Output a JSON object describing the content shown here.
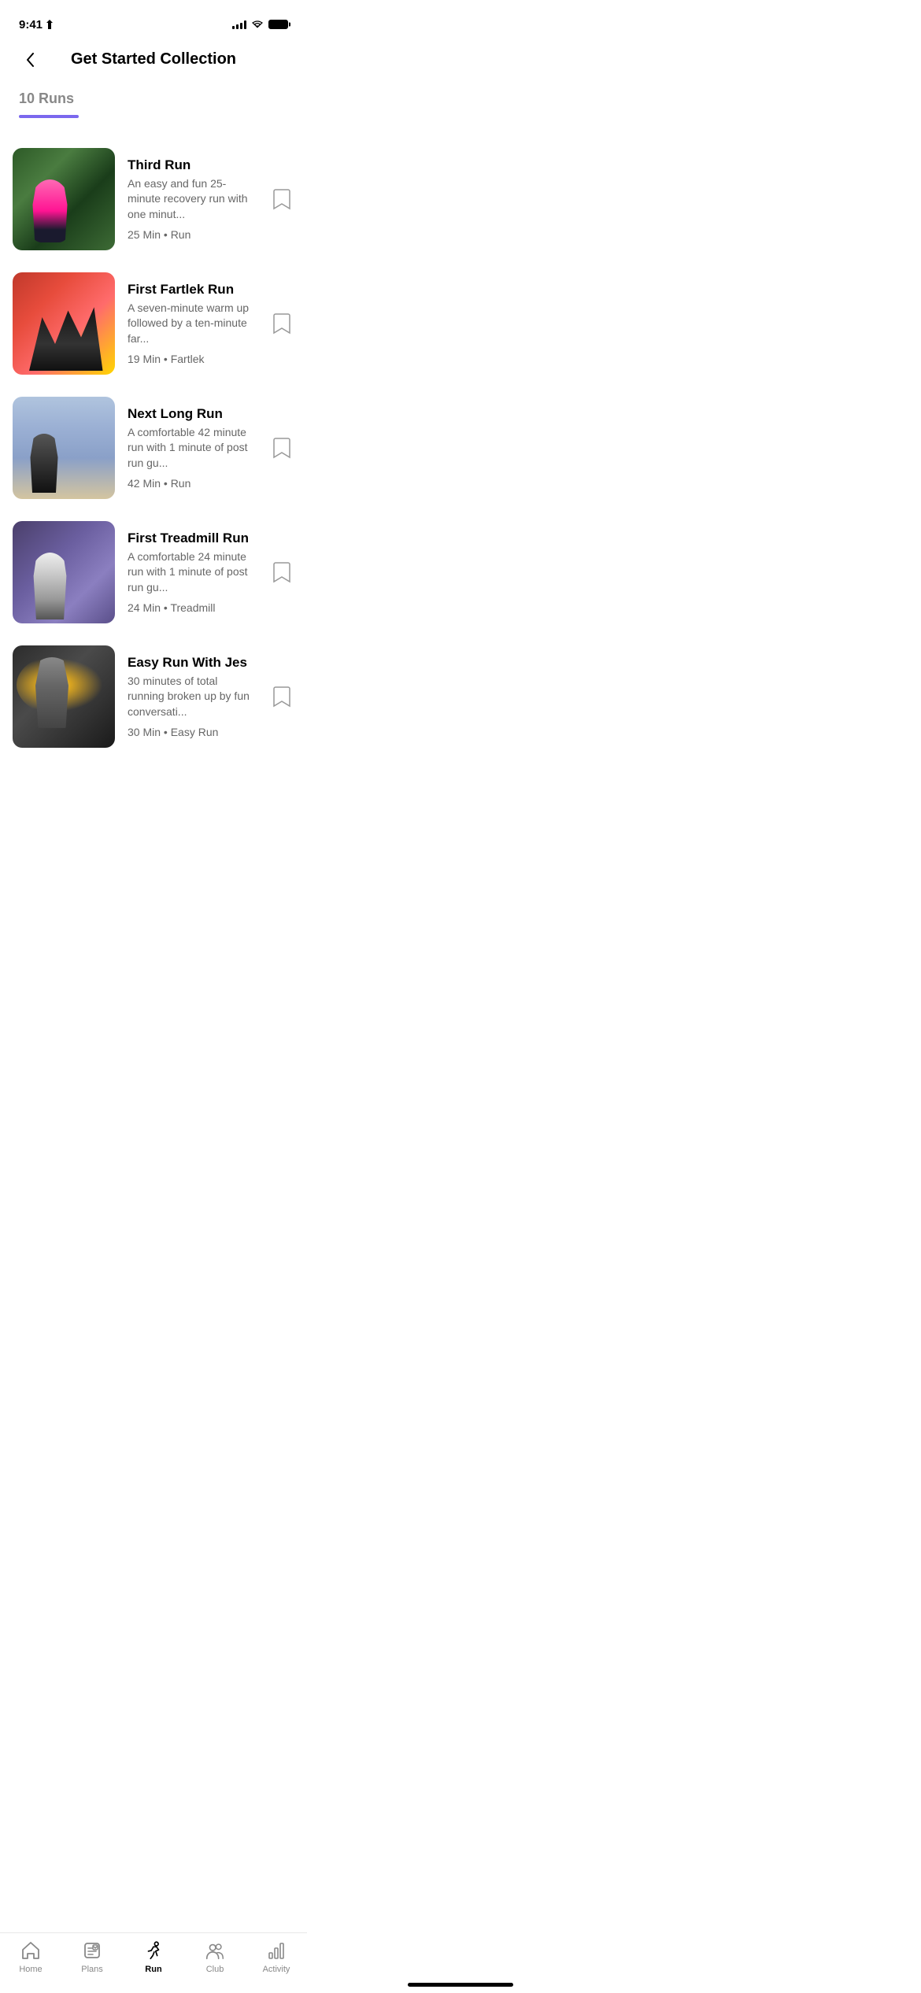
{
  "statusBar": {
    "time": "9:41",
    "locationIcon": "▶"
  },
  "header": {
    "title": "Get Started Collection",
    "backLabel": "back"
  },
  "runsSection": {
    "count": "10 Runs"
  },
  "runs": [
    {
      "id": "third-run",
      "title": "Third Run",
      "description": "An easy and fun 25-minute recovery run with one minut...",
      "meta": "25 Min • Run",
      "thumbClass": "thumb-third-run"
    },
    {
      "id": "first-fartlek-run",
      "title": "First Fartlek Run",
      "description": "A seven-minute warm up followed by a ten-minute far...",
      "meta": "19  Min • Fartlek",
      "thumbClass": "thumb-fartlek"
    },
    {
      "id": "next-long-run",
      "title": "Next Long Run",
      "description": "A comfortable 42 minute run with 1 minute of post run gu...",
      "meta": "42 Min • Run",
      "thumbClass": "thumb-long-run"
    },
    {
      "id": "first-treadmill-run",
      "title": "First Treadmill Run",
      "description": "A comfortable 24 minute run with 1 minute of post run gu...",
      "meta": "24 Min • Treadmill",
      "thumbClass": "thumb-treadmill"
    },
    {
      "id": "easy-run-with-jes",
      "title": "Easy Run With Jes",
      "description": "30 minutes of total running broken up by fun conversati...",
      "meta": "30 Min • Easy Run",
      "thumbClass": "thumb-easy-run"
    }
  ],
  "bottomNav": {
    "items": [
      {
        "id": "home",
        "label": "Home",
        "active": false
      },
      {
        "id": "plans",
        "label": "Plans",
        "active": false
      },
      {
        "id": "run",
        "label": "Run",
        "active": true
      },
      {
        "id": "club",
        "label": "Club",
        "active": false
      },
      {
        "id": "activity",
        "label": "Activity",
        "active": false
      }
    ]
  }
}
